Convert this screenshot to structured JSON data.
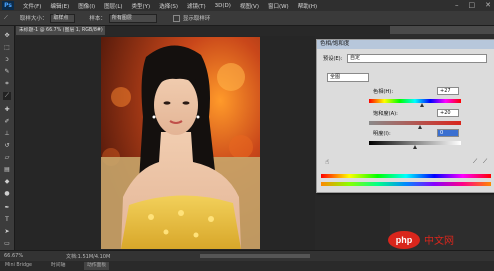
{
  "app": {
    "logo": "Ps"
  },
  "menubar": {
    "items": [
      "文件(F)",
      "编辑(E)",
      "图像(I)",
      "图层(L)",
      "类型(Y)",
      "选择(S)",
      "滤镜(T)",
      "3D(D)",
      "视图(V)",
      "窗口(W)",
      "帮助(H)"
    ]
  },
  "options": {
    "size_label": "取样大小：",
    "size_value": "取样点",
    "sample_label": "样本：",
    "sample_value": "所有图层",
    "ring_label": "显示取样环"
  },
  "document": {
    "tab": "未标题-1 @ 66.7% (图层 1, RGB/8#)",
    "zoom": "66.67%",
    "doc_info": "文档:1.51M/4.10M"
  },
  "bottom": {
    "tabs": [
      "Mini Bridge",
      "时间轴",
      "动作面板"
    ]
  },
  "dialog": {
    "title": "色相/饱和度",
    "preset_label": "预设(E):",
    "preset_value": "自定",
    "channel_value": "全图",
    "hue_label": "色相(H):",
    "hue_value": "+27",
    "sat_label": "饱和度(A):",
    "sat_value": "+20",
    "light_label": "明度(I):",
    "light_value": "0",
    "hue_pct": 0.58,
    "sat_pct": 0.55,
    "light_pct": 0.5
  },
  "watermark": {
    "text": "php 中文网"
  },
  "colors": {
    "accent": "#4aa3ff",
    "dialog_title": "#b7c7db",
    "watermark_red": "#d9261c"
  }
}
